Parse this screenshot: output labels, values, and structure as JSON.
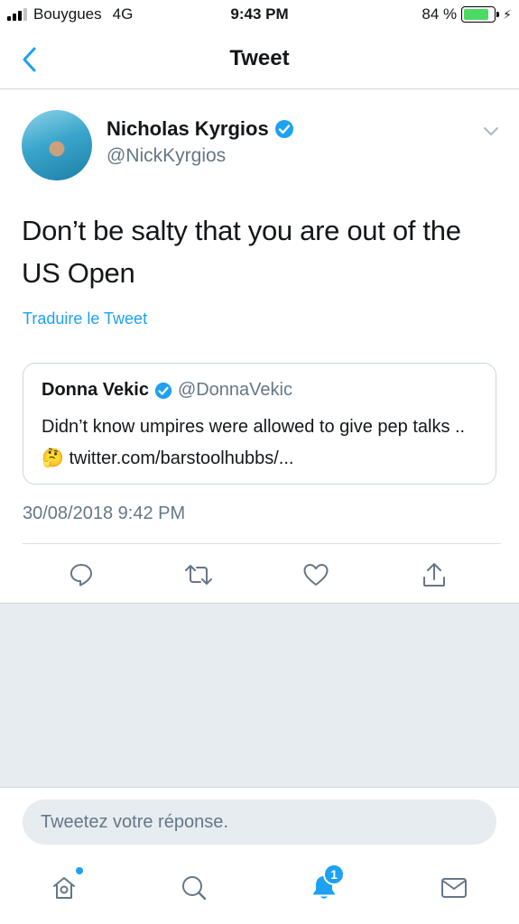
{
  "status_bar": {
    "carrier": "Bouygues",
    "network": "4G",
    "time": "9:43 PM",
    "battery_percent": "84 %",
    "battery_level": 0.84
  },
  "nav": {
    "title": "Tweet",
    "back_icon": "chevron-left-icon"
  },
  "tweet": {
    "author_name": "Nicholas Kyrgios",
    "author_handle": "@NickKyrgios",
    "verified": true,
    "text": "Don’t be salty that you are out of the US Open",
    "translate_label": "Traduire le Tweet",
    "quoted": {
      "author_name": "Donna Vekic",
      "author_handle": "@DonnaVekic",
      "verified": true,
      "text": "Didn’t know umpires were allowed to give pep talks .. 🤔 twitter.com/barstoolhubbs/..."
    },
    "timestamp": "30/08/2018 9:42 PM",
    "actions": [
      "reply-icon",
      "retweet-icon",
      "like-icon",
      "share-icon"
    ]
  },
  "reply": {
    "placeholder": "Tweetez votre réponse."
  },
  "tabbar": {
    "tabs": [
      "home-icon",
      "search-icon",
      "notifications-icon",
      "messages-icon"
    ],
    "notification_count": "1"
  },
  "colors": {
    "accent": "#1da1f2",
    "text": "#14171a",
    "secondary": "#657786",
    "background": "#e6ecf0"
  }
}
